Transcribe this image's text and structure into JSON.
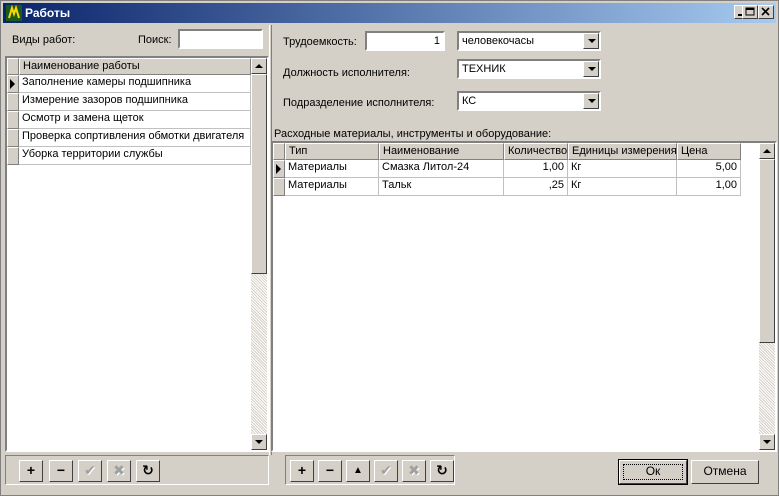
{
  "window": {
    "title": "Работы"
  },
  "left": {
    "types_label": "Виды работ:",
    "search_label": "Поиск:",
    "search_value": "",
    "grid_header": "Наименование работы",
    "items": [
      "Заполнение камеры подшипника",
      "Измерение зазоров подшипника",
      "Осмотр и замена щеток",
      "Проверка сопртивления обмотки двигателя",
      "Уборка территории службы"
    ]
  },
  "right": {
    "labor_label": "Трудоемкость:",
    "labor_value": "1",
    "labor_unit": "человекочасы",
    "position_label": "Должность исполнителя:",
    "position_value": "ТЕХНИК",
    "division_label": "Подразделение исполнителя:",
    "division_value": "КС",
    "materials_label": "Расходные материалы, инструменты и оборудование:",
    "columns": [
      "Тип",
      "Наименование",
      "Количество",
      "Единицы измерения",
      "Цена"
    ],
    "rows": [
      [
        "Материалы",
        "Смазка Литол-24",
        "1,00",
        "Кг",
        "5,00"
      ],
      [
        "Материалы",
        "Тальк",
        ",25",
        "Кг",
        "1,00"
      ]
    ]
  },
  "buttons": {
    "ok": "Ок",
    "cancel": "Отмена"
  },
  "icons": {
    "add": "+",
    "remove": "−",
    "up": "▲",
    "confirm": "✔",
    "cancel_edit": "✖",
    "refresh": "↻"
  }
}
